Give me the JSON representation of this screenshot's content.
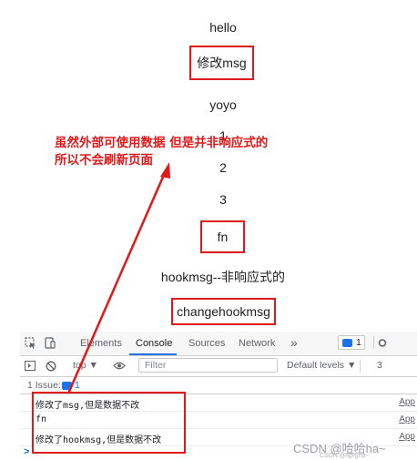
{
  "page": {
    "hello": "hello",
    "edit_msg_button": "修改msg",
    "yoyo": "yoyo",
    "list": [
      "1",
      "2",
      "3"
    ],
    "fn_button": "fn",
    "hook_label": "hookmsg--非响应式的",
    "change_hook_button": "changehookmsg"
  },
  "annotation": {
    "line1": "虽然外部可使用数据 但是并非响应式的",
    "line2": "所以不会刷新页面",
    "color": "#e0191b"
  },
  "devtools": {
    "tabs": [
      "Elements",
      "Console",
      "Sources",
      "Network"
    ],
    "more_tabs": "»",
    "active_tab": "Console",
    "issues_badge_count": "1",
    "toolbar": {
      "context": "top ▼",
      "filter_placeholder": "Filter",
      "levels": "Default levels ▼",
      "right_count": "3"
    },
    "issues_bar": {
      "label": "1 Issue:",
      "count": "1"
    },
    "logs": [
      {
        "message": "修改了msg,但是数据不改",
        "source": "App"
      },
      {
        "message": "fn",
        "source": "App"
      },
      {
        "message": "修改了hookmsg,但是数据不改",
        "source": "App"
      }
    ],
    "prompt": ">"
  },
  "watermark": {
    "main": "CSDN @哈哈ha~",
    "small": "CSDN @哈哈ha~"
  }
}
